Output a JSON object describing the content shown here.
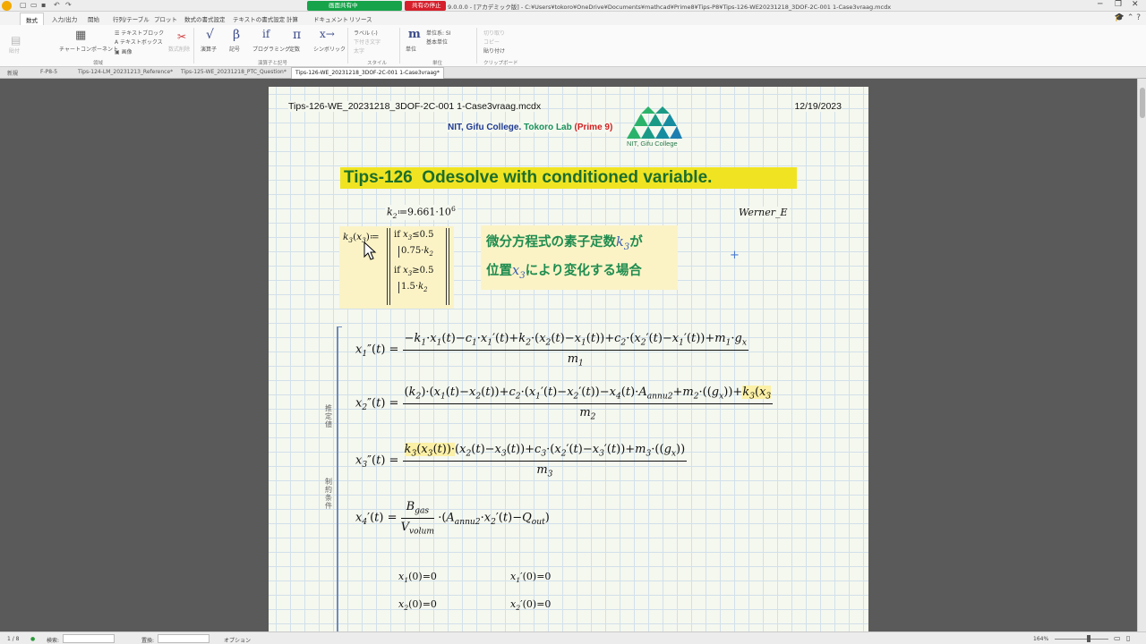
{
  "titlebar": {
    "share_status": "画面共有中",
    "share_stop": "共有の停止",
    "window_title": "9.0.0.0 - [アカデミック版] - C:¥Users¥tokoro¥OneDrive¥Documents¥mathcad¥Prime8¥Tips-P8¥Tips-126-WE20231218_3DOF-2C-001 1-Case3vraag.mcdx"
  },
  "ribbon": {
    "tabs": [
      "数式",
      "入力/出力",
      "開始",
      "行列/テーブル",
      "プロット",
      "数式の書式設定",
      "テキストの書式設定",
      "計算",
      "ドキュメント",
      "リソース"
    ],
    "active_tab": "数式",
    "items": {
      "paste": "貼付",
      "text_block": "テキストブロック",
      "text_box": "テキストボックス",
      "image": "画像",
      "chart_component": "チャートコンポーネント",
      "delete_region": "数式削除",
      "operators": "演算子",
      "symbols": "記号",
      "programming": "プログラミング",
      "constants": "定数",
      "symbolic": "シンボリック",
      "label": "ラベル (-)",
      "math_font": "下付き文字",
      "math_format": "太字",
      "units": "単位",
      "unit_system": "単位系: SI",
      "base_units": "基本単位",
      "cut": "切り取り",
      "copy": "コピー",
      "paste_clip": "貼り付け"
    },
    "groups": [
      "領域",
      "演算子と記号",
      "スタイル",
      "単位",
      "クリップボード"
    ]
  },
  "doc_tabs": [
    "新規",
    "F-P8-5",
    "Tips-124-LM_20231213_Reference*",
    "Tips-125-WE_20231218_PTC_Question*",
    "Tips-126-WE_20231218_3DOF-2C-001 1-Case3vraag*"
  ],
  "page": {
    "header_left": "Tips-126-WE_20231218_3DOF-2C-001 1-Case3vraag.mcdx",
    "header_right": "12/19/2023",
    "lab_part1": "NIT, Gifu College.",
    "lab_part2": "Tokoro Lab",
    "lab_part3": "(",
    "lab_part4": "Prime 9",
    "lab_part5": ")",
    "logo_text": "NIT, Gifu College",
    "banner": "Tips-126  Odesolve with conditioned variable.",
    "werner": "Werner_E",
    "note_line1": "微分方程式の素子定数",
    "note_line1_end": "が",
    "note_line2": "位置",
    "note_line2_end": "により変化する場合",
    "side_label1": "推定値",
    "side_label2": "制約条件"
  },
  "statusbar": {
    "page": "1 / 8",
    "search": "検索:",
    "replace": "置換:",
    "options": "オプション",
    "zoom": "164%"
  },
  "colors": {
    "banner_bg": "#f0e422",
    "banner_fg": "#1c6e2b",
    "note_fg": "#1f8c4f",
    "highlight": "#fbf3c6",
    "share_green": "#17a34a",
    "share_red": "#d61f2b"
  }
}
